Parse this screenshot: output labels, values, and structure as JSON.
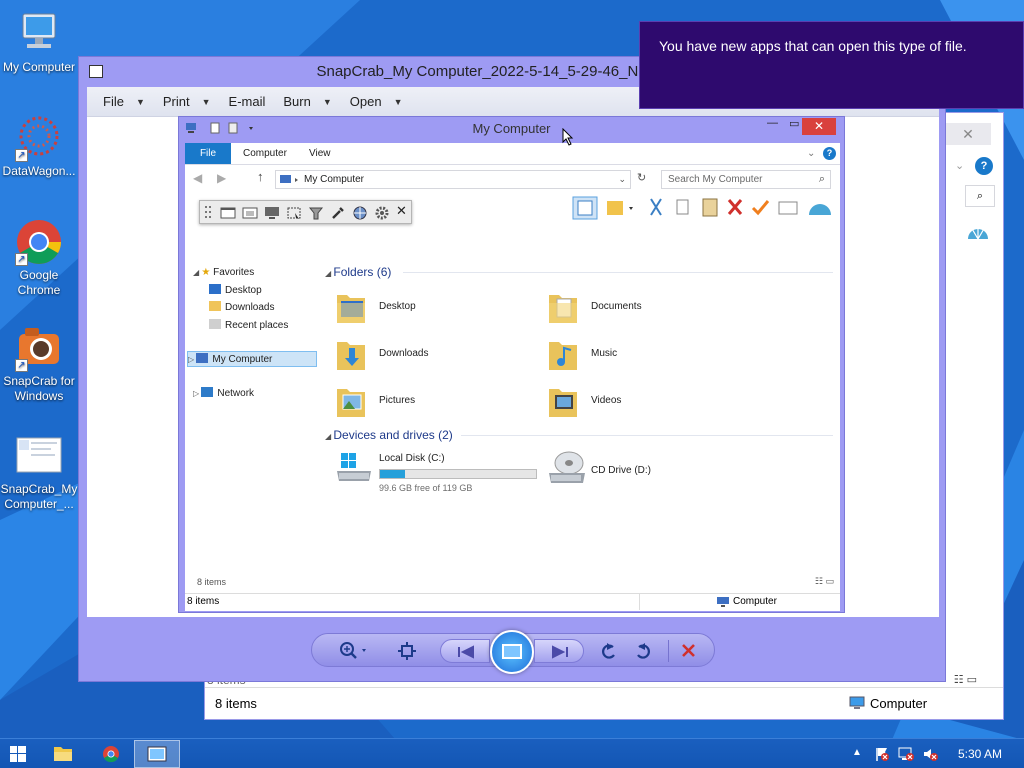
{
  "desktop": {
    "icons": [
      {
        "label": "My Computer"
      },
      {
        "label": "DataWagon..."
      },
      {
        "label": "Google Chrome"
      },
      {
        "label": "SnapCrab for Windows"
      },
      {
        "label": "SnapCrab_My Computer_..."
      }
    ]
  },
  "notification": {
    "text": "You have new apps that can open this type of file."
  },
  "viewer": {
    "title": "SnapCrab_My Computer_2022-5-14_5-29-46_No-00 - Win",
    "menu": [
      "File",
      "Print",
      "E-mail",
      "Burn",
      "Open"
    ]
  },
  "background_window": {
    "status_items": "8 items",
    "status_location": "Computer",
    "partial_items": "8 items"
  },
  "explorer": {
    "title": "My Computer",
    "tabs": [
      "File",
      "Computer",
      "View"
    ],
    "address": "My Computer",
    "search_placeholder": "Search My Computer",
    "nav": {
      "favorites": "Favorites",
      "desktop": "Desktop",
      "downloads": "Downloads",
      "recent": "Recent places",
      "my_computer": "My Computer",
      "network": "Network"
    },
    "folders_header": "Folders (6)",
    "folders": [
      "Desktop",
      "Documents",
      "Downloads",
      "Music",
      "Pictures",
      "Videos"
    ],
    "drives_header": "Devices and drives (2)",
    "drives": [
      {
        "name": "Local Disk (C:)",
        "free": "99.6 GB free of 119 GB",
        "used_fraction": 0.16
      },
      {
        "name": "CD Drive (D:)"
      }
    ],
    "content_count": "8 items",
    "status_items": "8 items",
    "status_location": "Computer"
  },
  "taskbar": {
    "time": "5:30 AM"
  }
}
